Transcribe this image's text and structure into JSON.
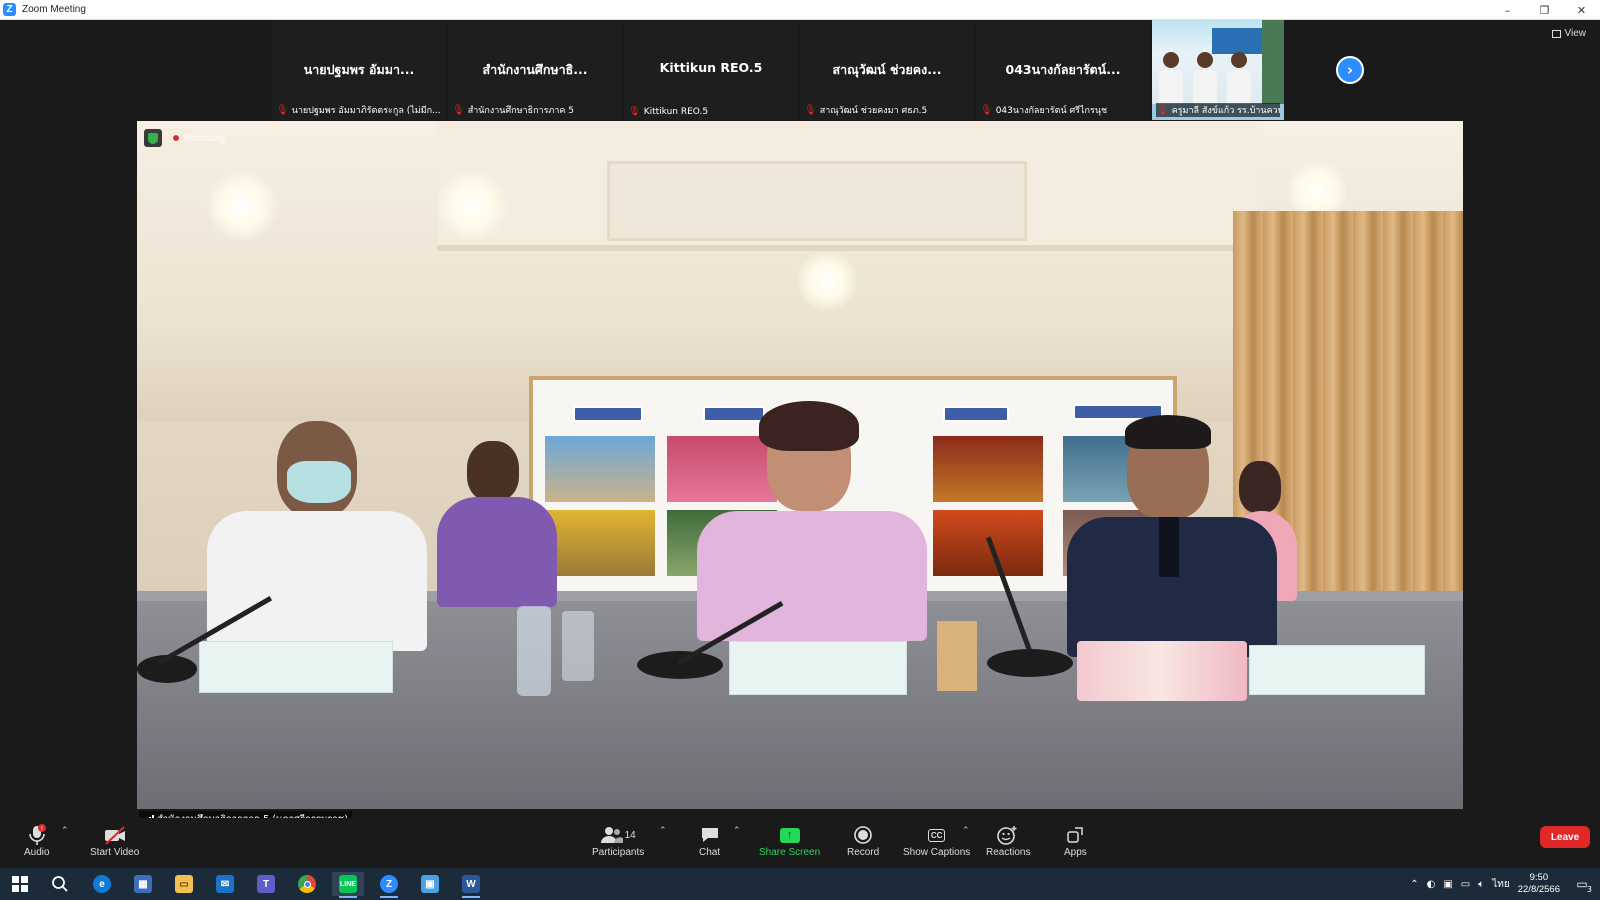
{
  "window": {
    "app_icon_letter": "Z",
    "title": "Zoom Meeting",
    "minimize": "–",
    "restore": "❐",
    "close": "✕"
  },
  "gallery": {
    "tiles": [
      {
        "display_name": "นายปฐมพร อัมมา...",
        "label": "นายปฐมพร อัมมาภิรัตตระกูล (ไม่มีก..."
      },
      {
        "display_name": "สำนักงานศึกษาธิ...",
        "label": "สำนักงานศึกษาธิการภาค 5"
      },
      {
        "display_name": "Kittikun REO.5",
        "label": "Kittikun REO.5"
      },
      {
        "display_name": "สาณุวัฒน์ ช่วยคง...",
        "label": "สาณุวัฒน์ ช่วยคงมา ศธภ.5"
      },
      {
        "display_name": "043นางกัลยารัตน์...",
        "label": "043นางกัลยารัตน์ ศรีไกรนุช"
      },
      {
        "display_name": "",
        "label": "ครูมาลี สังข์แก้ว รร.บ้านควนศรีวงศ์"
      }
    ],
    "next_icon": "›",
    "view_label": "View"
  },
  "main_video": {
    "recording_label": "Recording",
    "speaker_name": "สำนักงานศึกษาธิการภาค 5 (นครศรีธรรมราช)"
  },
  "toolbar": {
    "audio": "Audio",
    "start_video": "Start Video",
    "participants": "Participants",
    "participants_count": "14",
    "chat": "Chat",
    "share_screen": "Share Screen",
    "record": "Record",
    "show_captions": "Show Captions",
    "reactions": "Reactions",
    "apps": "Apps",
    "leave": "Leave",
    "cc_text": "CC"
  },
  "taskbar": {
    "language": "ไทย",
    "time": "9:50",
    "date": "22/8/2566",
    "notification_count": "3"
  },
  "colors": {
    "zoom_blue": "#2d8cff",
    "leave_red": "#e02828",
    "share_green": "#23d959",
    "muted_red": "#e02828"
  }
}
